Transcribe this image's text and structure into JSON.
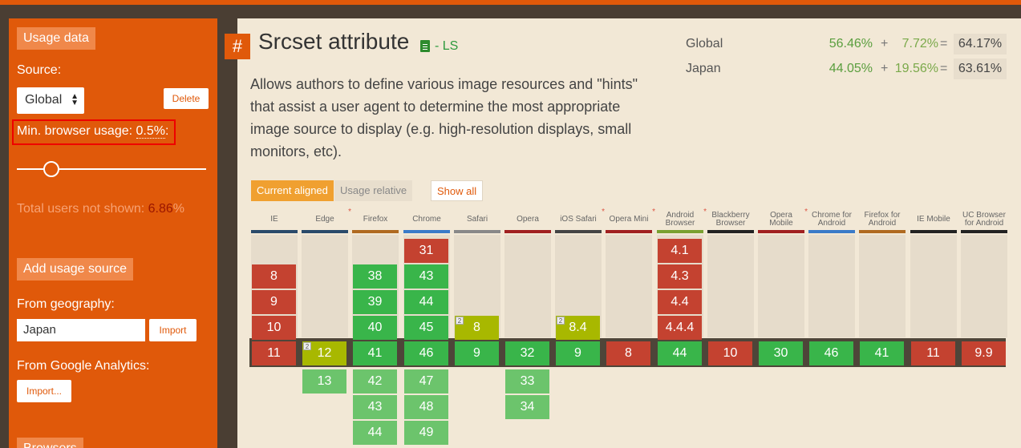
{
  "sidebar": {
    "usage_data": "Usage data",
    "source_label": "Source:",
    "source_value": "Global",
    "delete": "Delete",
    "min_usage_label": "Min. browser usage: ",
    "min_usage_value": "0.5%",
    "min_usage_suffix": ":",
    "slider_value_percent": 0.5,
    "total_label": "Total users not shown: ",
    "total_value": "6.86",
    "total_unit": "%",
    "add_source": "Add usage source",
    "from_geo": "From geography:",
    "geo_value": "Japan",
    "import": "Import",
    "from_ga": "From Google Analytics:",
    "import_dots": "Import...",
    "browsers": "Browsers"
  },
  "feature": {
    "hash": "#",
    "title": "Srcset attribute",
    "status": "- LS",
    "icon": "document-icon",
    "description": "Allows authors to define various image resources and \"hints\" that assist a user agent to determine the most appropriate image source to display (e.g. high-resolution displays, small monitors, etc)."
  },
  "stats": [
    {
      "geo": "Global",
      "full": "56.46%",
      "plus": "+",
      "partial": "7.72%",
      "eq": "=",
      "total": "64.17%"
    },
    {
      "geo": "Japan",
      "full": "44.05%",
      "plus": "+",
      "partial": "19.56%",
      "eq": "=",
      "total": "63.61%"
    }
  ],
  "toggles": {
    "current": "Current aligned",
    "relative": "Usage relative",
    "show_all": "Show all"
  },
  "colors": {
    "accent": "#e0590a",
    "supported": "#39b54a",
    "unsupported": "#c44230",
    "partial": "#a8b800"
  },
  "browsers": [
    {
      "name": "IE",
      "star": false,
      "line": "#2a4a6a"
    },
    {
      "name": "Edge",
      "star": true,
      "line": "#2a4a6a"
    },
    {
      "name": "Firefox",
      "star": false,
      "line": "#b06a20"
    },
    {
      "name": "Chrome",
      "star": false,
      "line": "#3a7ac8"
    },
    {
      "name": "Safari",
      "star": false,
      "line": "#888888"
    },
    {
      "name": "Opera",
      "star": false,
      "line": "#a02020"
    },
    {
      "name": "iOS Safari",
      "star": true,
      "line": "#444444"
    },
    {
      "name": "Opera Mini",
      "star": true,
      "line": "#a02020"
    },
    {
      "name": "Android Browser",
      "star": true,
      "line": "#7aa030"
    },
    {
      "name": "Blackberry Browser",
      "star": false,
      "line": "#222222"
    },
    {
      "name": "Opera Mobile",
      "star": true,
      "line": "#a02020"
    },
    {
      "name": "Chrome for Android",
      "star": false,
      "line": "#3a7ac8"
    },
    {
      "name": "Firefox for Android",
      "star": false,
      "line": "#b06a20"
    },
    {
      "name": "IE Mobile",
      "star": false,
      "line": "#222222"
    },
    {
      "name": "UC Browser for Android",
      "star": false,
      "line": "#222222"
    }
  ],
  "versions": [
    {
      "past": [
        [
          "8",
          "r"
        ],
        [
          "9",
          "r"
        ],
        [
          "10",
          "r"
        ]
      ],
      "current": [
        "11",
        "r"
      ],
      "future": []
    },
    {
      "past": [],
      "current": [
        "12",
        "y",
        "2"
      ],
      "future": [
        [
          "13",
          "lg"
        ]
      ]
    },
    {
      "past": [
        [
          "38",
          "g"
        ],
        [
          "39",
          "g"
        ],
        [
          "40",
          "g"
        ]
      ],
      "current": [
        "41",
        "g"
      ],
      "future": [
        [
          "42",
          "lg"
        ],
        [
          "43",
          "lg"
        ],
        [
          "44",
          "lg"
        ]
      ]
    },
    {
      "past": [
        [
          "31",
          "r"
        ],
        [
          "43",
          "g"
        ],
        [
          "44",
          "g"
        ],
        [
          "45",
          "g"
        ]
      ],
      "current": [
        "46",
        "g"
      ],
      "future": [
        [
          "47",
          "lg"
        ],
        [
          "48",
          "lg"
        ],
        [
          "49",
          "lg"
        ]
      ]
    },
    {
      "past": [
        [
          "8",
          "y",
          "2"
        ]
      ],
      "current": [
        "9",
        "g"
      ],
      "future": []
    },
    {
      "past": [],
      "current": [
        "32",
        "g"
      ],
      "future": [
        [
          "33",
          "lg"
        ],
        [
          "34",
          "lg"
        ]
      ]
    },
    {
      "past": [
        [
          "8.4",
          "y",
          "2"
        ]
      ],
      "current": [
        "9",
        "g"
      ],
      "future": []
    },
    {
      "past": [],
      "current": [
        "8",
        "r"
      ],
      "future": []
    },
    {
      "past": [
        [
          "4.1",
          "r"
        ],
        [
          "4.3",
          "r"
        ],
        [
          "4.4",
          "r"
        ],
        [
          "4.4.4",
          "r"
        ]
      ],
      "current": [
        "44",
        "g"
      ],
      "future": []
    },
    {
      "past": [],
      "current": [
        "10",
        "r"
      ],
      "future": []
    },
    {
      "past": [],
      "current": [
        "30",
        "g"
      ],
      "future": []
    },
    {
      "past": [],
      "current": [
        "46",
        "g"
      ],
      "future": []
    },
    {
      "past": [],
      "current": [
        "41",
        "g"
      ],
      "future": []
    },
    {
      "past": [],
      "current": [
        "11",
        "r"
      ],
      "future": []
    },
    {
      "past": [],
      "current": [
        "9.9",
        "r"
      ],
      "future": []
    }
  ]
}
